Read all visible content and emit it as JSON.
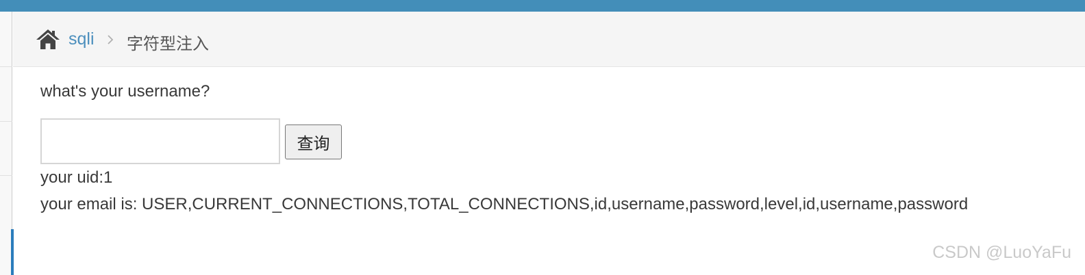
{
  "breadcrumb": {
    "home_icon": "home-icon",
    "link_label": "sqli",
    "separator_icon": "chevron-right-icon",
    "current_label": "字符型注入"
  },
  "form": {
    "question": "what's your username?",
    "input_value": "",
    "input_placeholder": "",
    "submit_label": "查询"
  },
  "result": {
    "uid_line": "your uid:1",
    "email_line": "your email is: USER,CURRENT_CONNECTIONS,TOTAL_CONNECTIONS,id,username,password,level,id,username,password"
  },
  "watermark": "CSDN @LuoYaFu",
  "colors": {
    "topbar": "#438eb9",
    "link": "#4c8fbd",
    "text": "#393939",
    "breadcrumb_bg": "#f5f5f5",
    "sidebar_active": "#2b7dbc"
  }
}
